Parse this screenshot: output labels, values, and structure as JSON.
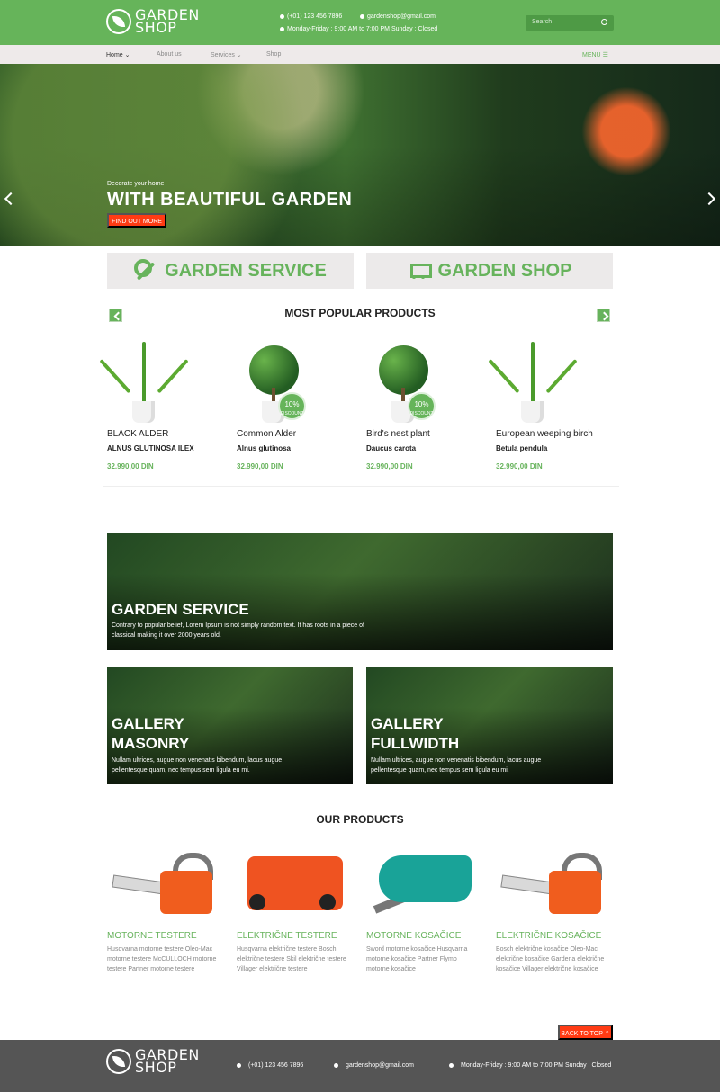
{
  "brand": {
    "name_line1": "GARDEN",
    "name_line2": "SHOP"
  },
  "header": {
    "phone": "(+01) 123 456 7896",
    "email": "gardenshop@gmail.com",
    "hours": "Monday-Friday : 9:00 AM to 7:00 PM Sunday : Closed",
    "search_placeholder": "Search"
  },
  "nav": {
    "items": [
      "Home",
      "About us",
      "Services",
      "Shop"
    ],
    "menu": "MENU"
  },
  "hero": {
    "subtitle": "Decorate your home",
    "title": "WITH BEAUTIFUL GARDEN",
    "button": "FIND OUT MORE"
  },
  "quick_links": {
    "service": "GARDEN SERVICE",
    "shop": "GARDEN SHOP"
  },
  "popular": {
    "title": "MOST POPULAR PRODUCTS",
    "items": [
      {
        "name": "BLACK ALDER",
        "subtitle": "ALNUS GLUTINOSA ILEX",
        "price": "32.990,00 DIN"
      },
      {
        "name": "Common Alder",
        "subtitle": "Alnus glutinosa",
        "price": "32.990,00 DIN",
        "badge": "10%",
        "badge_sub": "DISCOUNT"
      },
      {
        "name": "Bird's nest plant",
        "subtitle": "Daucus carota",
        "price": "32.990,00 DIN",
        "badge": "10%",
        "badge_sub": "DISCOUNT"
      },
      {
        "name": "European weeping birch",
        "subtitle": "Betula pendula",
        "price": "32.990,00 DIN"
      }
    ]
  },
  "garden_service": {
    "title": "GARDEN SERVICE",
    "text_line1": "Contrary to popular belief, Lorem Ipsum is not simply random text. It has roots in a piece of",
    "text_line2": "classical making it over 2000 years old."
  },
  "gallery": [
    {
      "title_line1": "GALLERY",
      "title_line2": "MASONRY",
      "text_line1": "Nullam ultrices, augue non venenatis bibendum, lacus augue",
      "text_line2": "pellentesque quam, nec tempus sem ligula eu mi."
    },
    {
      "title_line1": "GALLERY",
      "title_line2": "FULLWIDTH",
      "text_line1": "Nullam ultrices, augue non venenatis bibendum, lacus augue",
      "text_line2": "pellentesque quam, nec tempus sem ligula eu mi."
    }
  ],
  "our_products": {
    "title": "OUR PRODUCTS",
    "items": [
      {
        "title": "MOTORNE TESTERE",
        "desc_line1": "Husqvarna motorne testere Oleo-Mac",
        "desc_line2": "motorne testere McCULLOCH motorne",
        "desc_line3": "testere Partner motorne testere"
      },
      {
        "title": "ELEKTRIČNE TESTERE",
        "desc_line1": "Husqvarna električne testere Bosch",
        "desc_line2": "električne testere Skil električne testere",
        "desc_line3": "Villager električne testere"
      },
      {
        "title": "MOTORNE KOSAČICE",
        "desc_line1": "Sword motorne kosačice Husqvarna",
        "desc_line2": "motorne kosačice Partner Flymo",
        "desc_line3": "motorne kosačice"
      },
      {
        "title": "ELEKTRIČNE KOSAČICE",
        "desc_line1": "Bosch električne kosačice Oleo-Mac",
        "desc_line2": "električne kosačice Gardena električne",
        "desc_line3": "kosačice Villager električne kosačice"
      }
    ]
  },
  "back_to_top": "BACK TO TOP",
  "footer": {
    "phone": "(+01) 123 456 7896",
    "email": "gardenshop@gmail.com",
    "hours": "Monday-Friday : 9:00 AM to 7:00 PM Sunday : Closed"
  },
  "colors": {
    "green": "#66b45a",
    "orange": "#ff3b14",
    "footer": "#555555"
  }
}
